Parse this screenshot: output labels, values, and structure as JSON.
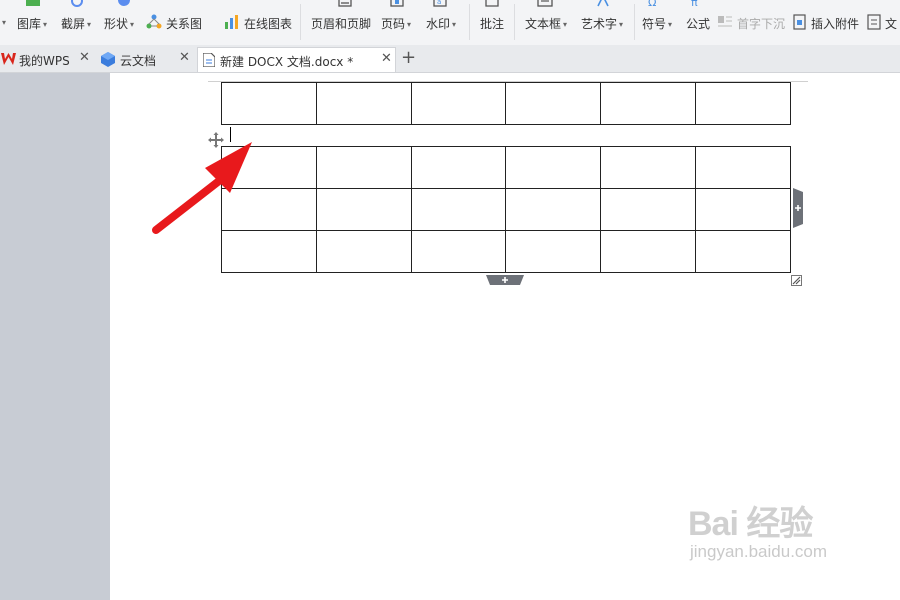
{
  "ribbon": {
    "items": [
      {
        "label": "图库",
        "dropdown": true
      },
      {
        "label": "截屏",
        "dropdown": true
      },
      {
        "label": "形状",
        "dropdown": true
      },
      {
        "label": "关系图",
        "dropdown": false
      },
      {
        "label": "在线图表",
        "dropdown": false
      },
      {
        "label": "页眉和页脚",
        "dropdown": false
      },
      {
        "label": "页码",
        "dropdown": true
      },
      {
        "label": "水印",
        "dropdown": true
      },
      {
        "label": "批注",
        "dropdown": false
      },
      {
        "label": "文本框",
        "dropdown": true
      },
      {
        "label": "艺术字",
        "dropdown": true
      },
      {
        "label": "符号",
        "dropdown": true
      },
      {
        "label": "公式",
        "dropdown": false
      },
      {
        "label": "首字下沉",
        "dropdown": false,
        "disabled": true
      },
      {
        "label": "插入附件",
        "dropdown": false
      },
      {
        "label": "文",
        "dropdown": false
      }
    ]
  },
  "tabs": [
    {
      "label": "我的WPS",
      "icon": "wps-logo-icon",
      "closable": true
    },
    {
      "label": "云文档",
      "icon": "cloud-doc-icon",
      "closable": true
    },
    {
      "label": "新建 DOCX 文档.docx *",
      "icon": "document-icon",
      "closable": true,
      "active": true
    }
  ],
  "new_tab_symbol": "+",
  "table_top": {
    "rows": 1,
    "cols": 6
  },
  "table_main": {
    "rows": 3,
    "cols": 6
  },
  "watermark": {
    "main": "Bai 经验",
    "sub": "jingyan.baidu.com"
  },
  "colors": {
    "arrow": "#e8191c",
    "handle": "#6d7178",
    "wps_red": "#d9261c",
    "page": "#ffffff",
    "workspace": "#c8ccd4"
  }
}
